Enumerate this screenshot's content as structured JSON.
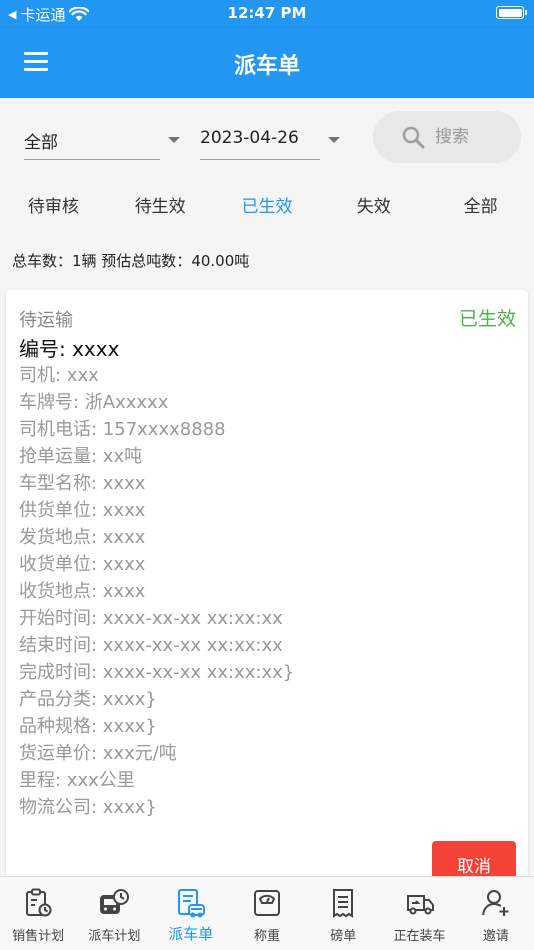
{
  "status_bar": {
    "carrier": "卡运通",
    "time": "12:47 PM"
  },
  "app_bar": {
    "title": "派车单"
  },
  "filters": {
    "category": "全部",
    "date": "2023-04-26",
    "search_placeholder": "搜索"
  },
  "tabs": [
    {
      "label": "待审核",
      "active": false
    },
    {
      "label": "待生效",
      "active": false
    },
    {
      "label": "已生效",
      "active": true
    },
    {
      "label": "失效",
      "active": false
    },
    {
      "label": "全部",
      "active": false
    }
  ],
  "summary": "总车数：1辆 预估总吨数：40.00吨",
  "order": {
    "status": "待运输",
    "state": "已生效",
    "code": "编号: xxxx",
    "fields": [
      "司机: xxx",
      "车牌号: 浙Axxxxx",
      "司机电话: 157xxxx8888",
      "抢单运量: xx吨",
      "车型名称: xxxx",
      "供货单位: xxxx",
      "发货地点: xxxx",
      "收货单位: xxxx",
      "收货地点: xxxx",
      "开始时间: xxxx-xx-xx xx:xx:xx",
      "结束时间: xxxx-xx-xx xx:xx:xx",
      "完成时间: xxxx-xx-xx xx:xx:xx}",
      "产品分类: xxxx}",
      "品种规格: xxxx}",
      "货运单价: xxx元/吨",
      "里程: xxx公里",
      "物流公司: xxxx}"
    ],
    "cancel_label": "取消"
  },
  "bottom_nav": [
    {
      "label": "销售计划",
      "icon": "sales-plan-icon",
      "active": false
    },
    {
      "label": "派车计划",
      "icon": "dispatch-plan-icon",
      "active": false
    },
    {
      "label": "派车单",
      "icon": "dispatch-order-icon",
      "active": true
    },
    {
      "label": "称重",
      "icon": "scale-icon",
      "active": false
    },
    {
      "label": "磅单",
      "icon": "receipt-icon",
      "active": false
    },
    {
      "label": "正在装车",
      "icon": "loading-truck-icon",
      "active": false
    },
    {
      "label": "邀请",
      "icon": "invite-user-icon",
      "active": false
    }
  ],
  "colors": {
    "primary": "#2196f3",
    "active_state": "#4caf50",
    "cancel": "#f44336"
  }
}
